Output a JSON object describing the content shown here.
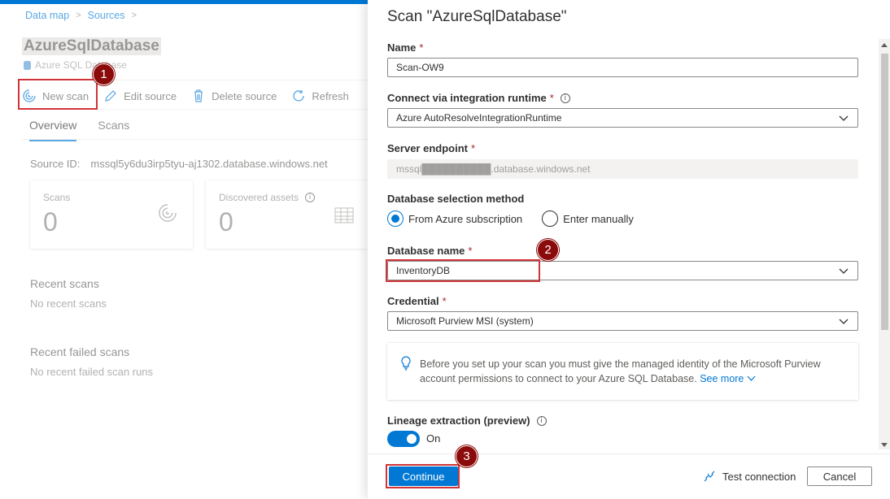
{
  "breadcrumb": {
    "items": [
      "Data map",
      "Sources"
    ]
  },
  "source": {
    "title": "AzureSqlDatabase",
    "subtitle": "Azure SQL Database",
    "toolbar": {
      "new_scan": "New scan",
      "edit_source": "Edit source",
      "delete_source": "Delete source",
      "refresh": "Refresh"
    },
    "tabs": [
      "Overview",
      "Scans"
    ],
    "source_id_label": "Source ID:",
    "source_id_value": "mssql5y6du3irp5tyu-aj1302.database.windows.net",
    "cards": [
      {
        "label": "Scans",
        "value": "0",
        "icon": "scan-icon"
      },
      {
        "label": "Discovered assets",
        "value": "0",
        "icon": "table-icon"
      }
    ],
    "recent_scans_title": "Recent scans",
    "recent_scans_empty": "No recent scans",
    "recent_failed_title": "Recent failed scans",
    "recent_failed_empty": "No recent failed scan runs"
  },
  "panel": {
    "title": "Scan \"AzureSqlDatabase\"",
    "name_label": "Name",
    "name_value": "Scan-OW9",
    "runtime_label": "Connect via integration runtime",
    "runtime_value": "Azure AutoResolveIntegrationRuntime",
    "endpoint_label": "Server endpoint",
    "endpoint_value": "mssql██████████.database.windows.net",
    "selection_label": "Database selection method",
    "selection_options": [
      "From Azure subscription",
      "Enter manually"
    ],
    "selection_selected": "From Azure subscription",
    "dbname_label": "Database name",
    "dbname_value": "InventoryDB",
    "credential_label": "Credential",
    "credential_value": "Microsoft Purview MSI (system)",
    "info_text": "Before you set up your scan you must give the managed identity of the Microsoft Purview account permissions to connect to your Azure SQL Database.",
    "info_link": "See more",
    "lineage_label": "Lineage extraction (preview)",
    "lineage_state": "On",
    "continue_label": "Continue",
    "test_label": "Test connection",
    "cancel_label": "Cancel"
  },
  "annotations": {
    "step1": "1",
    "step2": "2",
    "step3": "3"
  },
  "colors": {
    "accent": "#0078d4",
    "annotation": "#d13438",
    "badge": "#8b0a0a"
  }
}
